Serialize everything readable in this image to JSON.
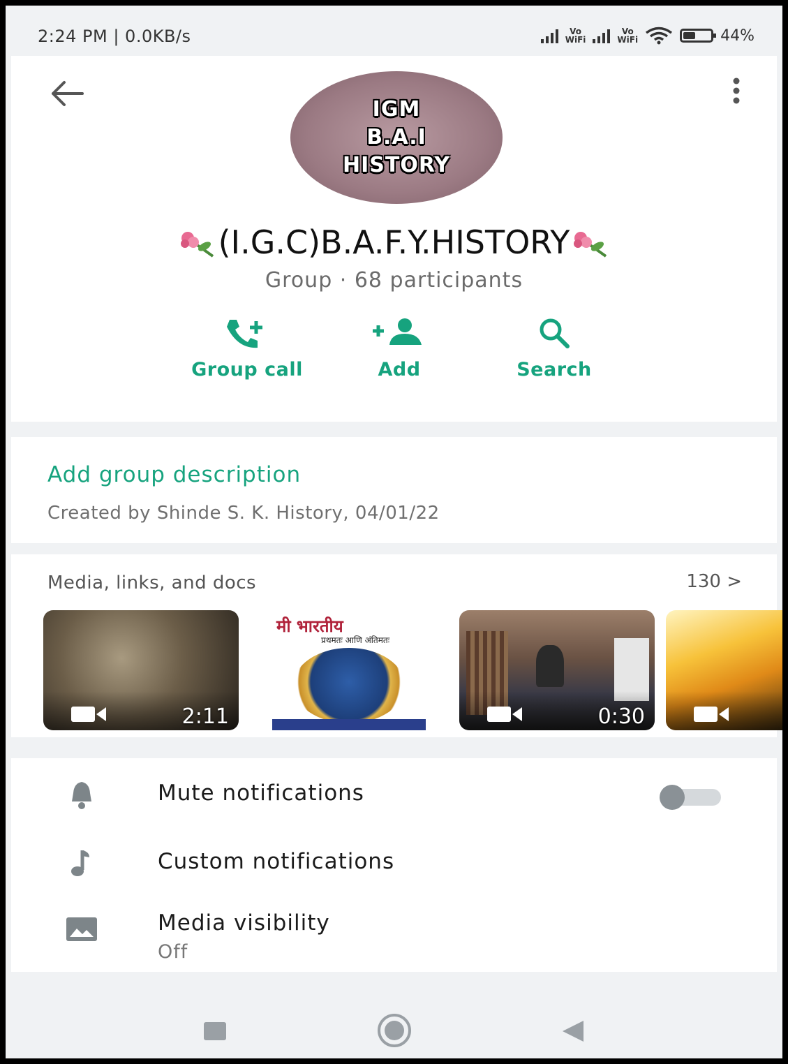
{
  "status_bar": {
    "time_speed": "2:24 PM | 0.0KB/s",
    "vo_label": "Vo",
    "wifi_label": "WiFi",
    "battery_percent": "44%",
    "battery_level": 0.44
  },
  "header": {
    "avatar_lines": [
      "IGM",
      "B.A.I",
      "HISTORY"
    ],
    "group_name": "(I.G.C)B.A.F.Y.HISTORY",
    "group_info": "Group · 68 participants",
    "actions": [
      {
        "label": "Group call",
        "icon": "group-call-icon"
      },
      {
        "label": "Add",
        "icon": "add-person-icon"
      },
      {
        "label": "Search",
        "icon": "search-icon"
      }
    ],
    "accent_color": "#16a37e"
  },
  "description": {
    "title": "Add group description",
    "created_by": "Created by Shinde S. K. History, 04/01/22"
  },
  "media": {
    "title": "Media, links, and docs",
    "count": "130 >",
    "thumbnails": [
      {
        "type": "video",
        "duration": "2:11"
      },
      {
        "type": "image",
        "caption_top": "मी भारतीय",
        "caption_sub": "प्रथमतः आणि अंतिमतः"
      },
      {
        "type": "video",
        "duration": "0:30"
      },
      {
        "type": "video",
        "duration": ""
      }
    ]
  },
  "settings": {
    "mute": {
      "title": "Mute notifications",
      "enabled": false
    },
    "custom": {
      "title": "Custom notifications"
    },
    "visibility": {
      "title": "Media visibility",
      "value": "Off"
    }
  },
  "nav": {
    "buttons": [
      "recents-button",
      "home-button",
      "back-button"
    ]
  }
}
